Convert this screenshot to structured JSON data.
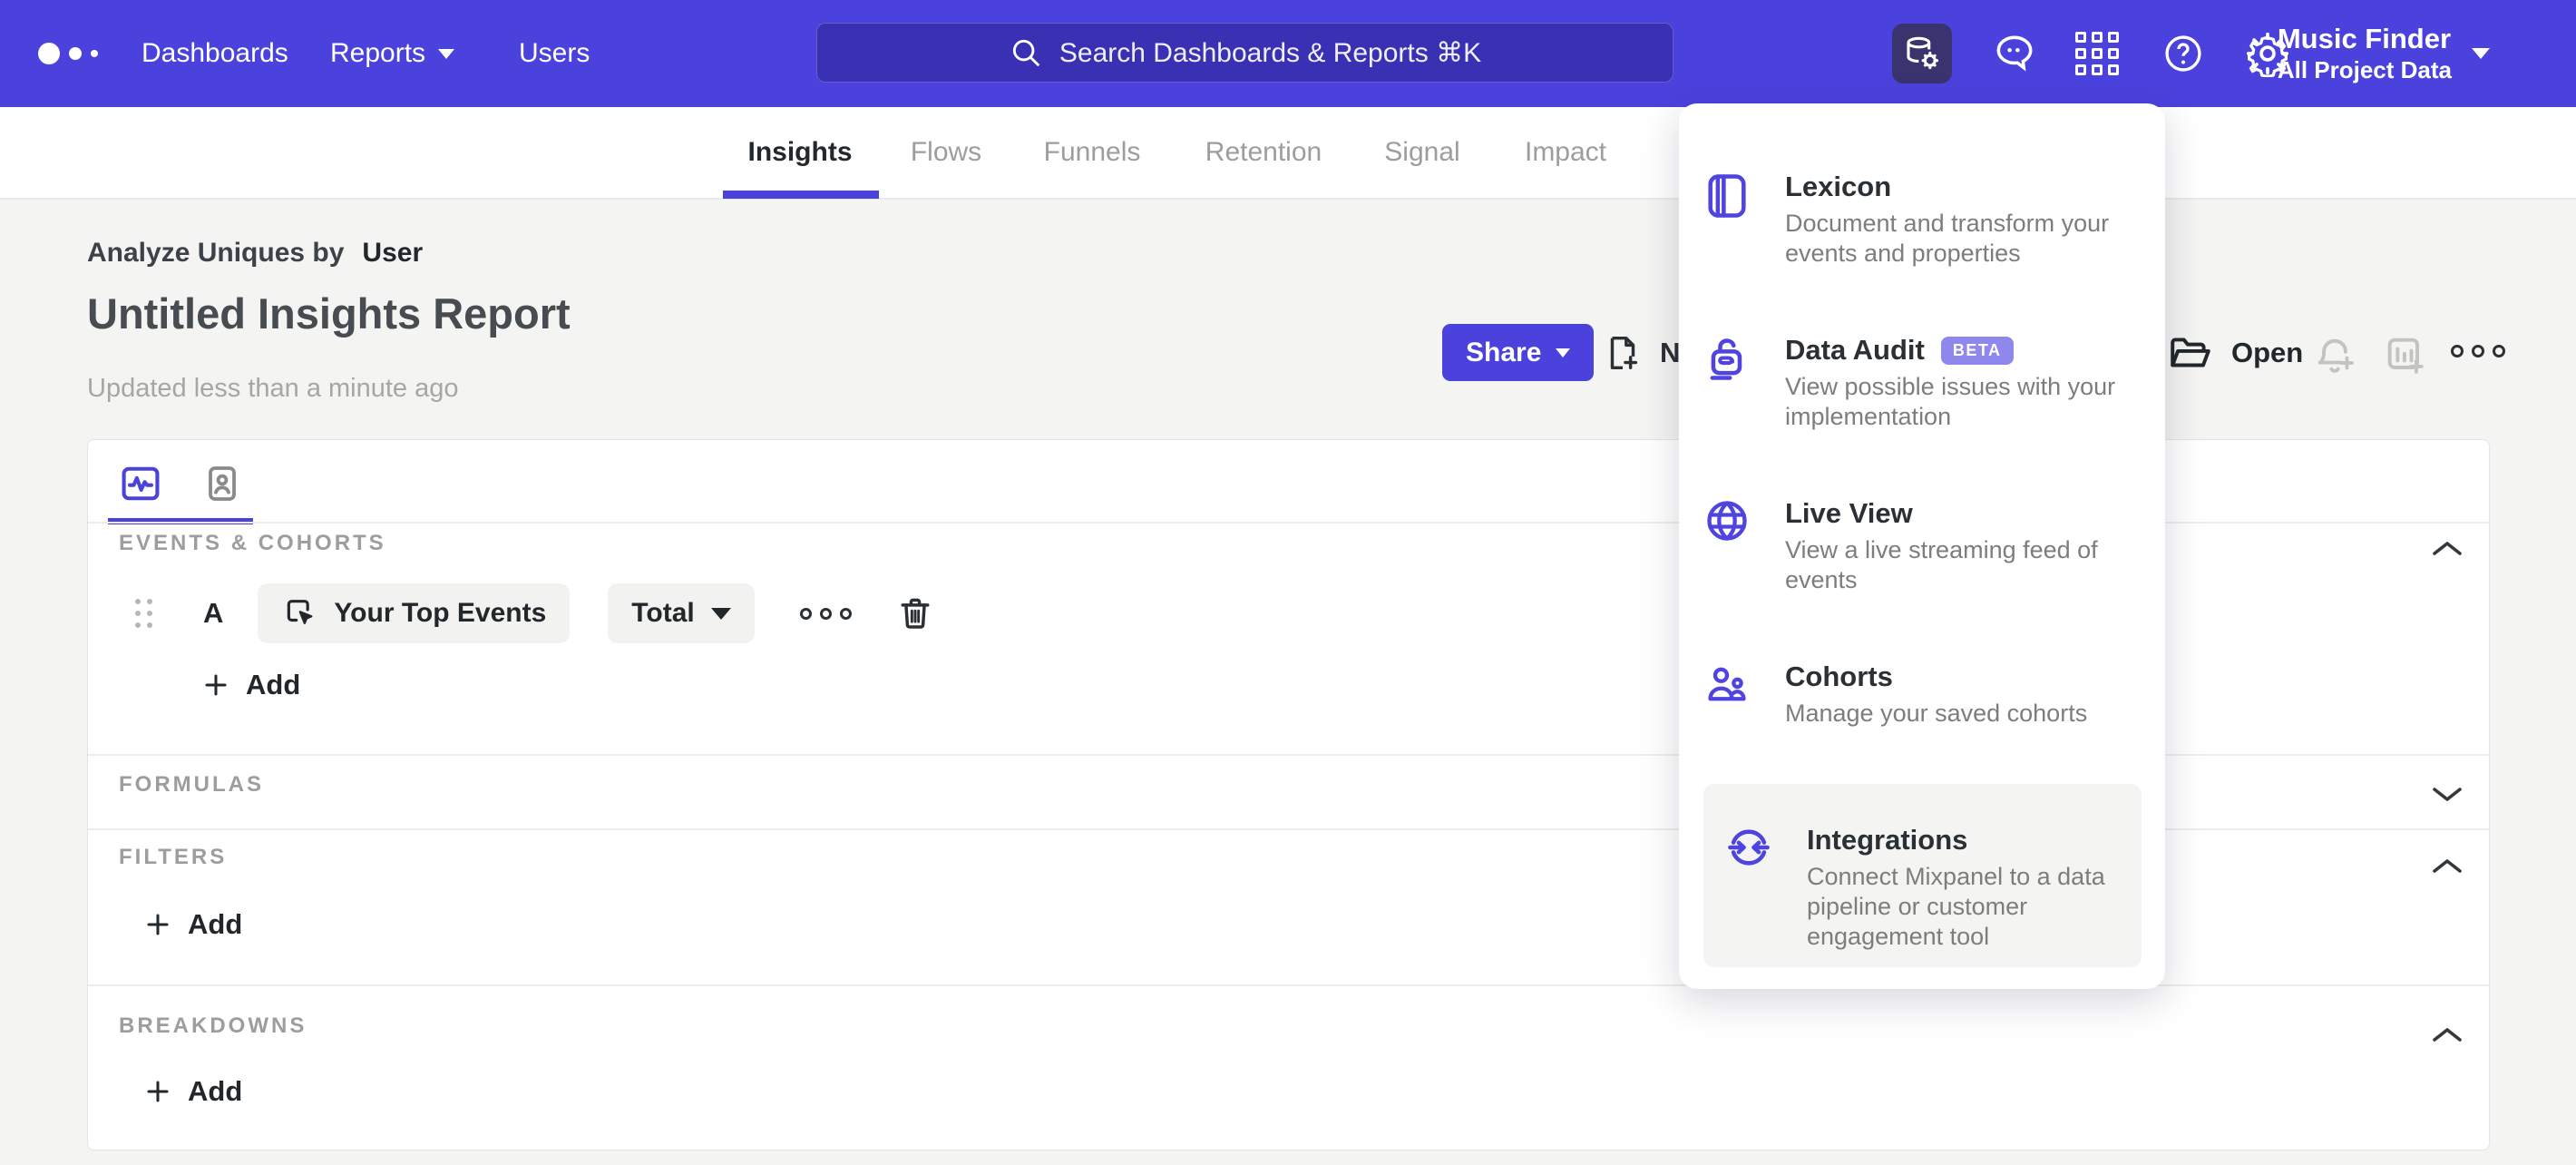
{
  "colors": {
    "accent": "#4B42DE",
    "accent_tile": "#3A346E",
    "icon_indigo": "#4F44E0",
    "beta_bg": "#8f88ec",
    "content_bg": "#f4f4f2"
  },
  "nav": {
    "items": [
      {
        "label": "Dashboards",
        "has_caret": false
      },
      {
        "label": "Reports",
        "has_caret": true
      },
      {
        "label": "Users",
        "has_caret": false
      }
    ],
    "search_placeholder": "Search Dashboards & Reports ⌘K",
    "icon_buttons": [
      "data-management",
      "feedback",
      "apps",
      "help",
      "settings"
    ],
    "project_name": "Music Finder",
    "project_scope": "All Project Data"
  },
  "report_tabs": [
    {
      "label": "Insights",
      "active": true
    },
    {
      "label": "Flows",
      "active": false
    },
    {
      "label": "Funnels",
      "active": false
    },
    {
      "label": "Retention",
      "active": false
    },
    {
      "label": "Signal",
      "active": false
    },
    {
      "label": "Impact",
      "active": false
    }
  ],
  "header": {
    "analyze_prefix": "Analyze Uniques by",
    "analyze_value": "User",
    "title": "Untitled Insights Report",
    "updated": "Updated less than a minute ago",
    "share_label": "Share",
    "new_label_clipped": "Ne",
    "open_label": "Open"
  },
  "tools_menu": {
    "items": [
      {
        "title": "Lexicon",
        "description": "Document and transform your events and properties",
        "icon": "lexicon-book-icon"
      },
      {
        "title": "Data Audit",
        "badge": "BETA",
        "description": "View possible issues with your implementation",
        "icon": "data-audit-lock-icon"
      },
      {
        "title": "Live View",
        "description": "View a live streaming feed of events",
        "icon": "live-view-globe-icon"
      },
      {
        "title": "Cohorts",
        "description": "Manage your saved cohorts",
        "icon": "cohorts-users-icon"
      },
      {
        "title": "Integrations",
        "description": "Connect Mixpanel to a data pipeline or customer engagement tool",
        "icon": "integrations-sync-icon",
        "highlighted": true
      }
    ]
  },
  "builder": {
    "sections": {
      "events": {
        "label": "EVENTS & COHORTS",
        "add_label": "Add",
        "collapsed": false
      },
      "formulas": {
        "label": "FORMULAS",
        "collapsed": true
      },
      "filters": {
        "label": "FILTERS",
        "add_label": "Add",
        "collapsed": false
      },
      "breakdowns": {
        "label": "BREAKDOWNS",
        "add_label": "Add",
        "collapsed": false
      }
    },
    "event_row": {
      "letter": "A",
      "event_label": "Your Top Events",
      "metric_label": "Total"
    }
  }
}
